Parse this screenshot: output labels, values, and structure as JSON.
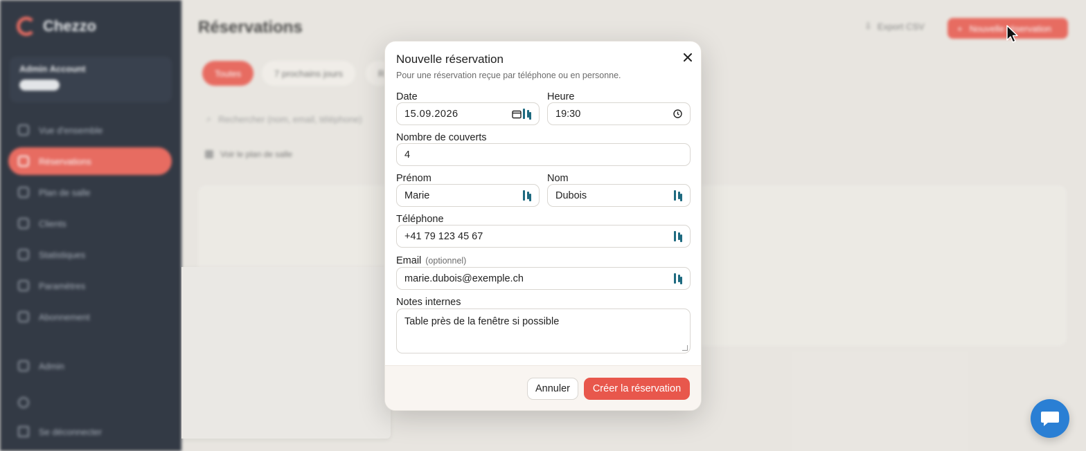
{
  "app": {
    "brand": "Chezzo",
    "account_name": "Admin Account",
    "account_badge": "",
    "page_title": "Réservations",
    "export_label": "Export CSV",
    "new_reservation_label": "Nouvelle réservation",
    "accent_color": "#e8574c"
  },
  "sidebar": {
    "items": [
      {
        "label": "Vue d'ensemble",
        "icon": "grid-icon"
      },
      {
        "label": "Réservations",
        "icon": "calendar-icon",
        "active": true
      },
      {
        "label": "Plan de salle",
        "icon": "layout-icon"
      },
      {
        "label": "Clients",
        "icon": "users-icon"
      },
      {
        "label": "Statistiques",
        "icon": "chart-icon"
      },
      {
        "label": "Paramètres",
        "icon": "gear-icon"
      },
      {
        "label": "Abonnement",
        "icon": "card-icon"
      },
      {
        "label": "Admin",
        "icon": "shield-icon"
      }
    ],
    "logout_label": "Se déconnecter"
  },
  "filters": {
    "tabs": [
      "Toutes",
      "7 prochains jours",
      "R"
    ],
    "search_placeholder": "Rechercher (nom, email, téléphone)",
    "plan_link": "Voir le plan de salle"
  },
  "modal": {
    "title": "Nouvelle réservation",
    "subtitle": "Pour une réservation reçue par téléphone ou en personne.",
    "date_label": "Date",
    "date_value": "15.09.2026",
    "time_label": "Heure",
    "time_value": "19:30",
    "covers_label": "Nombre de couverts",
    "covers_value": "4",
    "firstname_label": "Prénom",
    "firstname_value": "Marie",
    "lastname_label": "Nom",
    "lastname_value": "Dubois",
    "phone_label": "Téléphone",
    "phone_value": "+41 79 123 45 67",
    "email_label": "Email",
    "email_optional": "(optionnel)",
    "email_value": "marie.dubois@exemple.ch",
    "notes_label": "Notes internes",
    "notes_value": "Table près de la fenêtre si possible",
    "cancel_label": "Annuler",
    "create_label": "Créer la réservation"
  }
}
